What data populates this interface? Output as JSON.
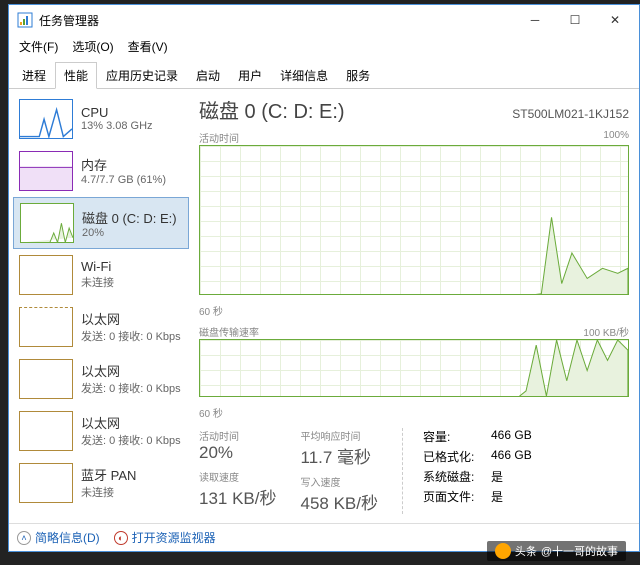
{
  "window": {
    "title": "任务管理器",
    "menus": {
      "file": "文件(F)",
      "options": "选项(O)",
      "view": "查看(V)"
    },
    "tabs": [
      "进程",
      "性能",
      "应用历史记录",
      "启动",
      "用户",
      "详细信息",
      "服务"
    ],
    "active_tab": 1
  },
  "sidebar": {
    "items": [
      {
        "title": "CPU",
        "sub": "13% 3.08 GHz",
        "color": "#2e7cd6"
      },
      {
        "title": "内存",
        "sub": "4.7/7.7 GB (61%)",
        "color": "#8a2bb5"
      },
      {
        "title": "磁盘 0 (C: D: E:)",
        "sub": "20%",
        "color": "#6bab3b"
      },
      {
        "title": "Wi-Fi",
        "sub": "未连接",
        "color": "#b08a3a"
      },
      {
        "title": "以太网",
        "sub": "发送: 0 接收: 0 Kbps",
        "color": "#b08a3a"
      },
      {
        "title": "以太网",
        "sub": "发送: 0 接收: 0 Kbps",
        "color": "#b08a3a"
      },
      {
        "title": "以太网",
        "sub": "发送: 0 接收: 0 Kbps",
        "color": "#b08a3a"
      },
      {
        "title": "蓝牙 PAN",
        "sub": "未连接",
        "color": "#b08a3a"
      }
    ],
    "selected": 2
  },
  "main": {
    "title": "磁盘 0 (C: D: E:)",
    "model": "ST500LM021-1KJ152",
    "chart1": {
      "label": "活动时间",
      "max": "100%",
      "xaxis": "60 秒"
    },
    "chart2": {
      "label": "磁盘传输速率",
      "max": "100 KB/秒",
      "xaxis": "60 秒"
    },
    "stats": {
      "active_time": {
        "label": "活动时间",
        "value": "20%"
      },
      "avg_response": {
        "label": "平均响应时间",
        "value": "11.7 毫秒"
      },
      "read_speed": {
        "label": "读取速度",
        "value": "131 KB/秒"
      },
      "write_speed": {
        "label": "写入速度",
        "value": "458 KB/秒"
      },
      "capacity": {
        "label": "容量:",
        "value": "466 GB"
      },
      "formatted": {
        "label": "已格式化:",
        "value": "466 GB"
      },
      "system_disk": {
        "label": "系统磁盘:",
        "value": "是"
      },
      "page_file": {
        "label": "页面文件:",
        "value": "是"
      }
    }
  },
  "footer": {
    "brief": "简略信息(D)",
    "resmon": "打开资源监视器"
  },
  "chart_data": [
    {
      "type": "area",
      "title": "活动时间",
      "ylabel": "%",
      "ylim": [
        0,
        100
      ],
      "x": [
        0,
        5,
        10,
        15,
        20,
        25,
        30,
        35,
        40,
        45,
        47,
        49,
        51,
        53,
        55,
        57,
        59,
        60
      ],
      "values": [
        0,
        0,
        0,
        0,
        0,
        0,
        0,
        0,
        0,
        0,
        2,
        5,
        3,
        55,
        10,
        30,
        15,
        20
      ]
    },
    {
      "type": "area",
      "title": "磁盘传输速率",
      "ylabel": "KB/秒",
      "ylim": [
        0,
        100
      ],
      "x": [
        0,
        5,
        10,
        15,
        20,
        25,
        30,
        35,
        40,
        45,
        47,
        49,
        51,
        53,
        55,
        57,
        59,
        60
      ],
      "values": [
        0,
        0,
        0,
        0,
        0,
        0,
        0,
        0,
        0,
        0,
        5,
        95,
        10,
        100,
        40,
        100,
        60,
        90
      ]
    }
  ],
  "credit": {
    "prefix": "头条",
    "user": "@十一哥的故事"
  }
}
